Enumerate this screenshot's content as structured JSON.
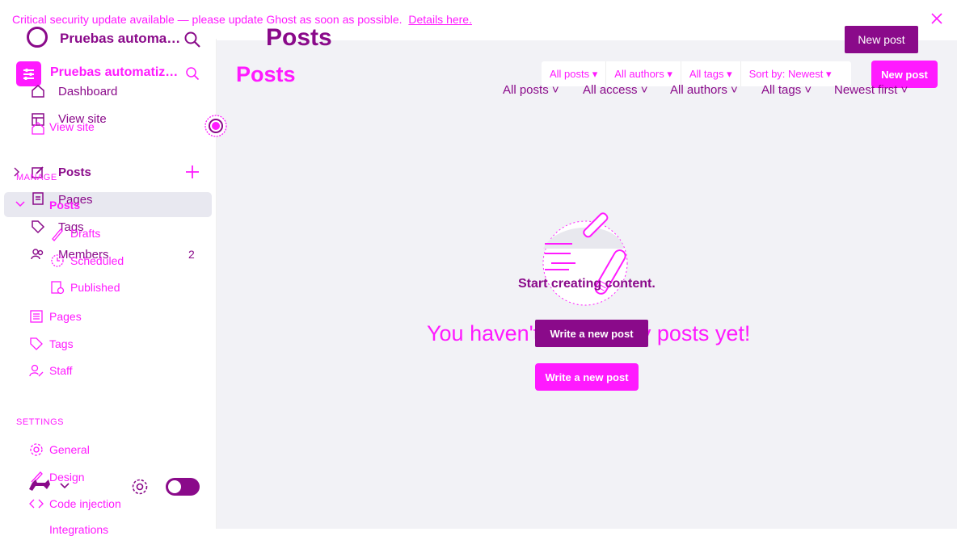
{
  "banner": {
    "text": "Critical security update available — please update Ghost as soon as possible.",
    "link": "Details here."
  },
  "site": {
    "name_primary": "Pruebas automa…",
    "name_secondary": "Pruebas automatiz…"
  },
  "sidebar_overlay": {
    "dashboard": "Dashboard",
    "view_site": "View site",
    "posts": "Posts",
    "pages": "Pages",
    "tags": "Tags",
    "members": "Members",
    "members_count": "2"
  },
  "sidebar": {
    "view_site": "View site",
    "manage_heading": "MANAGE",
    "posts": "Posts",
    "drafts": "Drafts",
    "scheduled": "Scheduled",
    "published": "Published",
    "pages": "Pages",
    "tags": "Tags",
    "staff": "Staff",
    "settings_heading": "SETTINGS",
    "general": "General",
    "design": "Design",
    "code_injection": "Code injection",
    "integrations": "Integrations"
  },
  "header": {
    "title_primary": "Posts",
    "title_secondary": "Posts",
    "new_post_primary": "New post",
    "new_post_secondary": "New post"
  },
  "filters_bar": {
    "all_posts": "All posts",
    "all_authors": "All authors",
    "all_tags": "All tags",
    "sort": "Sort by: Newest"
  },
  "filters_row": {
    "all_posts": "All posts",
    "all_access": "All access",
    "all_authors": "All authors",
    "all_tags": "All tags",
    "newest": "Newest first"
  },
  "empty_state": {
    "title": "Start creating content.",
    "message": "You haven't written any posts yet!",
    "button_primary": "Write a new post",
    "button_secondary": "Write a new post"
  },
  "colors": {
    "magenta_dark": "#8a0a8a",
    "magenta_bright": "#ff1aff",
    "main_bg": "#f2f2f6"
  },
  "icons": [
    "close-icon",
    "search-icon",
    "house-icon",
    "layout-icon",
    "pencil-square-icon",
    "plus-icon",
    "document-icon",
    "tag-icon",
    "people-icon",
    "chevron-right-icon",
    "chevron-down-icon",
    "pencil-icon",
    "clock-icon",
    "check-document-icon",
    "list-icon",
    "user-edit-icon",
    "gear-icon",
    "brush-icon",
    "code-icon",
    "target-icon",
    "cat-icon",
    "pen-illustration-icon"
  ]
}
